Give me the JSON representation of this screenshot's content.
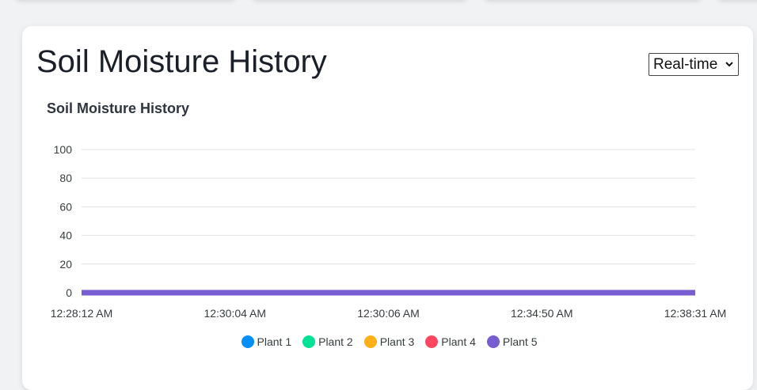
{
  "section": {
    "title": "Soil Moisture History"
  },
  "range_select": {
    "value": "Real-time"
  },
  "colors": {
    "plant1": "#008ffb",
    "plant2": "#00e396",
    "plant3": "#feb019",
    "plant4": "#ff4560",
    "plant5": "#775dd0"
  },
  "chart_data": {
    "type": "line",
    "title": "Soil Moisture History",
    "xlabel": "",
    "ylabel": "",
    "ylim": [
      0,
      100
    ],
    "y_ticks": [
      "100",
      "80",
      "60",
      "40",
      "20",
      "0"
    ],
    "x": [
      "12:28:12 AM",
      "12:30:04 AM",
      "12:30:06 AM",
      "12:34:50 AM",
      "12:38:31 AM"
    ],
    "series": [
      {
        "name": "Plant 1",
        "color": "#008ffb",
        "values": [
          0,
          0,
          0,
          0,
          0
        ]
      },
      {
        "name": "Plant 2",
        "color": "#00e396",
        "values": [
          0,
          0,
          0,
          0,
          0
        ]
      },
      {
        "name": "Plant 3",
        "color": "#feb019",
        "values": [
          0,
          0,
          0,
          0,
          0
        ]
      },
      {
        "name": "Plant 4",
        "color": "#ff4560",
        "values": [
          0,
          0,
          0,
          0,
          0
        ]
      },
      {
        "name": "Plant 5",
        "color": "#775dd0",
        "values": [
          0,
          0,
          0,
          0,
          0
        ]
      }
    ],
    "grid": true,
    "legend": "bottom"
  }
}
